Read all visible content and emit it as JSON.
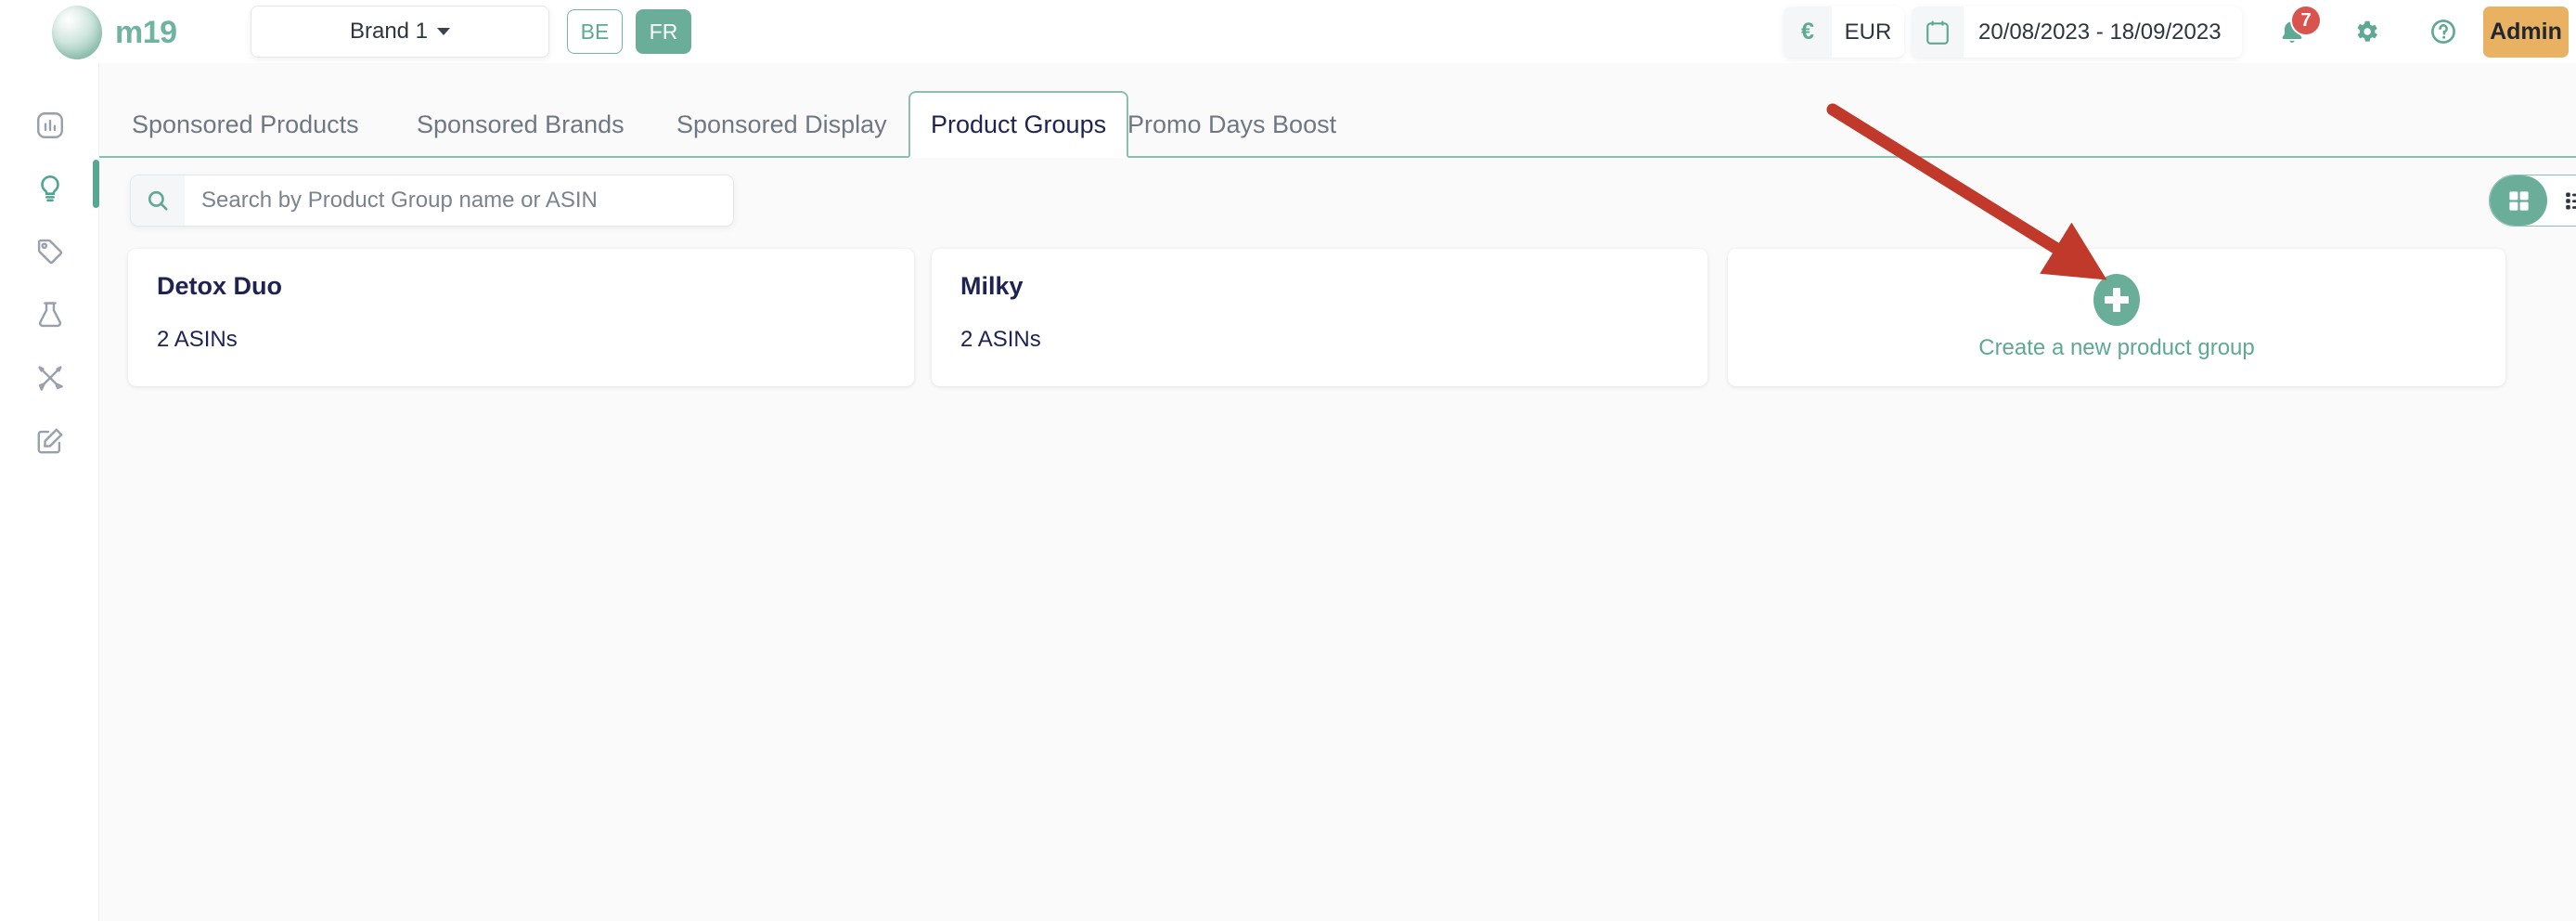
{
  "header": {
    "logo_text": "m19",
    "logo_icon": "m19-sphere-logo",
    "brand_selector": {
      "value": "Brand 1",
      "icon": "chevron-down-icon"
    },
    "marketplaces": [
      {
        "code": "BE",
        "active": false
      },
      {
        "code": "FR",
        "active": true
      }
    ],
    "currency": {
      "symbol": "€",
      "code": "EUR",
      "icon": "euro-icon"
    },
    "date_range": {
      "icon": "calendar-icon",
      "value": "20/08/2023 - 18/09/2023"
    },
    "notifications": {
      "icon": "bell-icon",
      "count": "7"
    },
    "settings_icon": "gear-icon",
    "help_icon": "help-circle-icon",
    "account_button": "Admin"
  },
  "sidebar": {
    "items": [
      {
        "icon": "analytics-chart-icon",
        "active": false
      },
      {
        "icon": "lightbulb-icon",
        "active": true
      },
      {
        "icon": "tag-icon",
        "active": false
      },
      {
        "icon": "flask-icon",
        "active": false
      },
      {
        "icon": "pencil-ruler-icon",
        "active": false
      },
      {
        "icon": "edit-square-icon",
        "active": false
      }
    ]
  },
  "main": {
    "tabs": [
      {
        "label": "Sponsored Products",
        "active": false
      },
      {
        "label": "Sponsored Brands",
        "active": false
      },
      {
        "label": "Sponsored Display",
        "active": false
      },
      {
        "label": "Product Groups",
        "active": true
      },
      {
        "label": "Promo Days Boost",
        "active": false
      }
    ],
    "search": {
      "icon": "search-icon",
      "value": "",
      "placeholder": "Search by Product Group name or ASIN"
    },
    "view_toggle": [
      {
        "icon": "grid-view-icon",
        "active": true
      },
      {
        "icon": "list-view-icon",
        "active": false
      }
    ],
    "product_groups": [
      {
        "name": "Detox Duo",
        "asin_count": "2 ASINs"
      },
      {
        "name": "Milky",
        "asin_count": "2 ASINs"
      }
    ],
    "create_card": {
      "icon": "plus-circle-icon",
      "label": "Create a new product group"
    }
  },
  "annotation": {
    "arrow_color": "#c0392b",
    "arrow_name": "red-pointer-arrow"
  },
  "colors": {
    "brand_green": "#6aae9a",
    "accent_green": "#5fa893",
    "admin_amber": "#e9b263",
    "badge_red": "#d9534f",
    "title_navy": "#1f2352",
    "page_bg": "#fafafa"
  }
}
